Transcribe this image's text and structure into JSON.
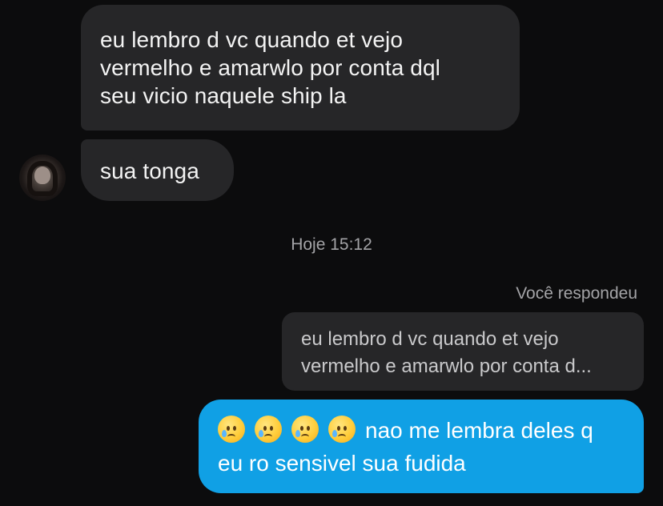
{
  "messages": {
    "incoming": [
      {
        "lines": [
          "eu lembro d vc quando et vejo",
          "vermelho e amarwlo por conta dql",
          "seu vicio naquele ship la"
        ]
      },
      {
        "lines": [
          "sua tonga"
        ]
      }
    ],
    "avatar_icon": "contact-avatar",
    "timestamp": "Hoje 15:12",
    "reply": {
      "label": "Você respondeu",
      "quoted_lines": [
        "eu lembro d vc quando et vejo",
        "vermelho e amarwlo por conta d..."
      ]
    },
    "outgoing": {
      "emojis": [
        "crying-face-emoji",
        "crying-face-emoji",
        "crying-face-emoji",
        "crying-face-emoji"
      ],
      "line_1": "nao me lembra deles q",
      "line_2": "eu ro sensivel sua fudida"
    }
  },
  "colors": {
    "background": "#0c0c0d",
    "incoming_bubble": "#262628",
    "outgoing_bubble": "#10a0e5",
    "secondary_text": "#a3a3a6"
  }
}
